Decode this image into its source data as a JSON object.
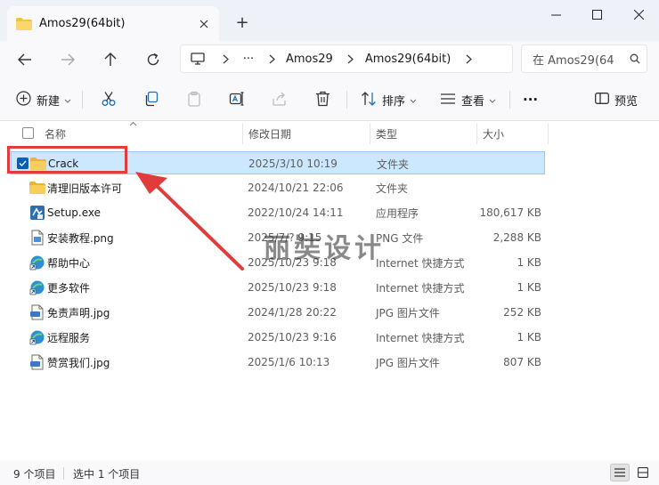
{
  "window": {
    "tab_title": "Amos29(64bit)",
    "new_tab": "+"
  },
  "address": {
    "overflow": "···",
    "crumbs": [
      "Amos29",
      "Amos29(64bit)"
    ],
    "search_placeholder": "在 Amos29(64"
  },
  "toolbar": {
    "new_label": "新建",
    "sort_label": "排序",
    "view_label": "查看",
    "more_label": "···",
    "preview_label": "预览"
  },
  "columns": {
    "name": "名称",
    "date": "修改日期",
    "type": "类型",
    "size": "大小"
  },
  "files": [
    {
      "name": "Crack",
      "date": "2025/3/10 10:19",
      "type": "文件夹",
      "size": "",
      "icon": "folder-icon",
      "selected": true
    },
    {
      "name": "清理旧版本许可",
      "date": "2024/10/21 22:06",
      "type": "文件夹",
      "size": "",
      "icon": "folder-icon",
      "selected": false
    },
    {
      "name": "Setup.exe",
      "date": "2022/10/24 14:11",
      "type": "应用程序",
      "size": "180,617 KB",
      "icon": "setup-exe-icon",
      "selected": false
    },
    {
      "name": "安装教程.png",
      "date": "2025/7/? 9:15",
      "type": "PNG 文件",
      "size": "2,288 KB",
      "icon": "png-file-icon",
      "selected": false
    },
    {
      "name": "帮助中心",
      "date": "2025/10/23 9:18",
      "type": "Internet 快捷方式",
      "size": "1 KB",
      "icon": "internet-shortcut-icon",
      "selected": false
    },
    {
      "name": "更多软件",
      "date": "2025/10/23 9:18",
      "type": "Internet 快捷方式",
      "size": "1 KB",
      "icon": "internet-shortcut-icon",
      "selected": false
    },
    {
      "name": "免责声明.jpg",
      "date": "2024/1/28 20:22",
      "type": "JPG 图片文件",
      "size": "252 KB",
      "icon": "jpg-file-icon",
      "selected": false
    },
    {
      "name": "远程服务",
      "date": "2025/10/23 9:16",
      "type": "Internet 快捷方式",
      "size": "1 KB",
      "icon": "internet-shortcut-icon",
      "selected": false
    },
    {
      "name": "赞赏我们.jpg",
      "date": "2025/1/6 10:13",
      "type": "JPG 图片文件",
      "size": "807 KB",
      "icon": "jpg-file-icon",
      "selected": false
    }
  ],
  "status": {
    "item_count": "9 个项目",
    "selected_count": "选中 1 个项目"
  },
  "overlay": {
    "watermark": "丽奘设计",
    "highlight_color": "#e03c3c"
  },
  "colors": {
    "selection_bg": "#cce8ff",
    "folder": "#f5c342",
    "accent": "#005fb8"
  }
}
